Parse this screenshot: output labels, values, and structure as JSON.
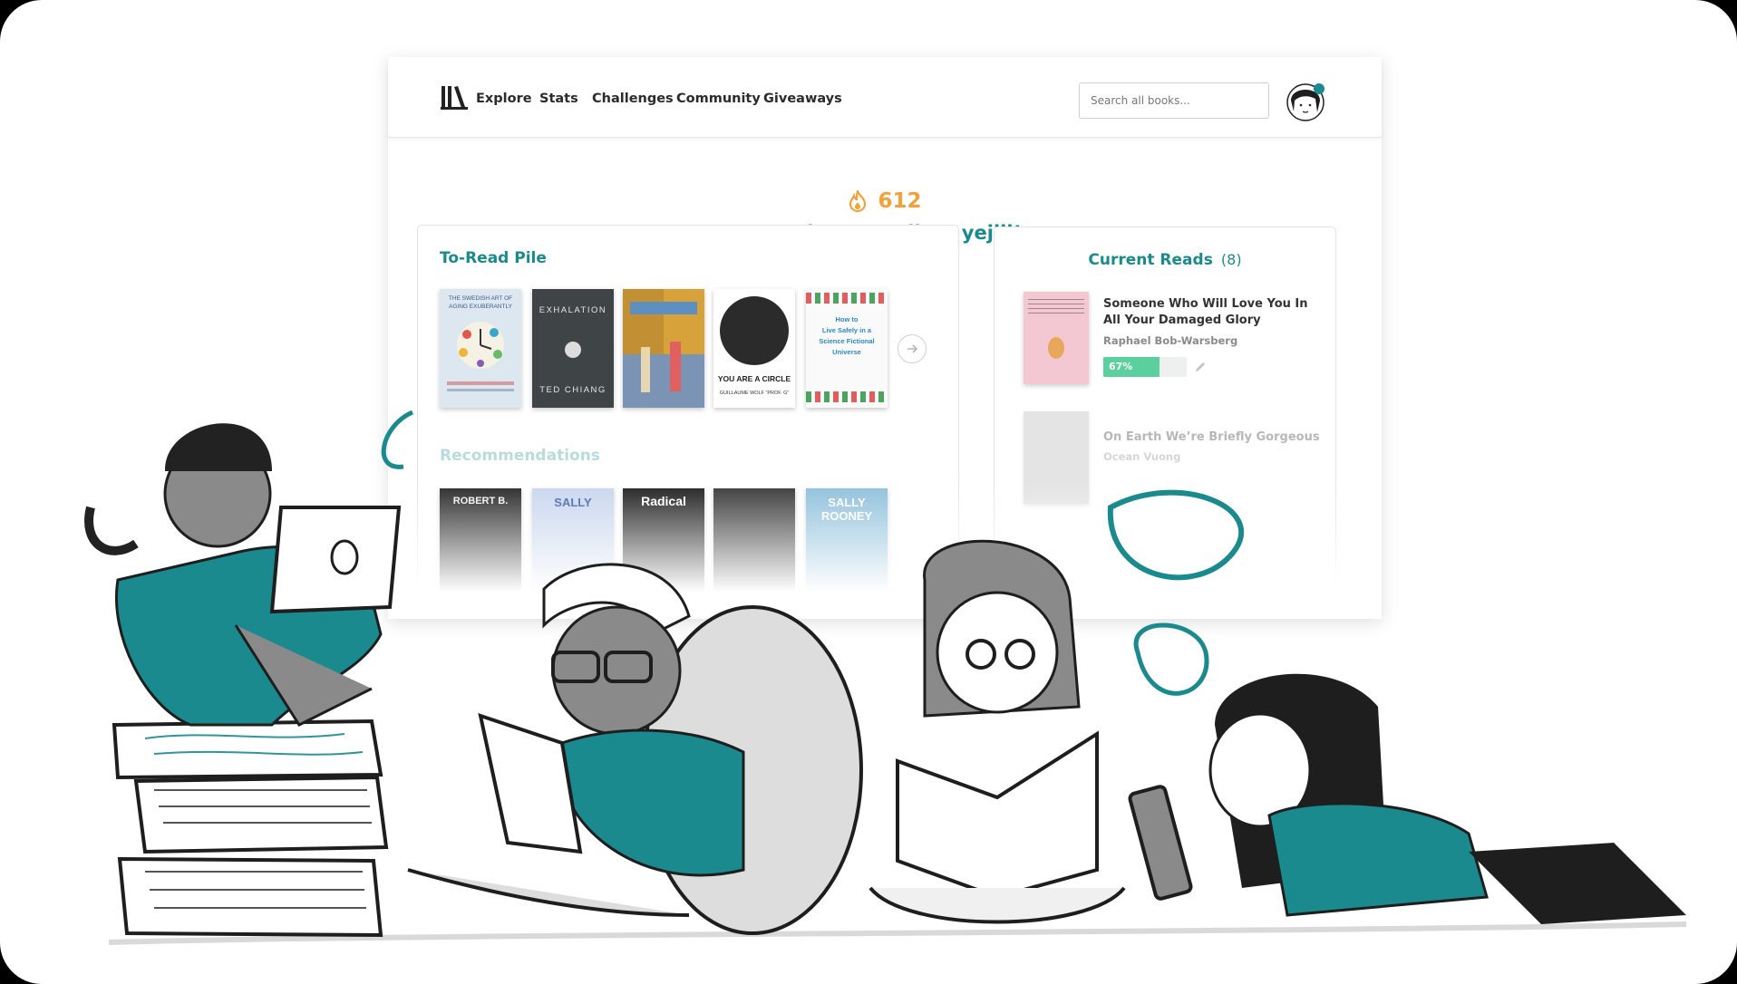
{
  "nav": {
    "links": [
      "Explore",
      "Stats",
      "Challenges",
      "Community",
      "Giveaways"
    ],
    "search_placeholder": "Search all books..."
  },
  "streak": {
    "count": "612",
    "greeting": "Let’s keep reading, yejiji!"
  },
  "to_read": {
    "title": "To-Read Pile",
    "covers": [
      {
        "text": [
          "THE SWEDISH ART OF",
          "AGING EXUBERANTLY"
        ]
      },
      {
        "text": [
          "EXHALATION",
          "TED CHIANG"
        ]
      },
      {
        "text": []
      },
      {
        "text": [
          "YOU ARE A CIRCLE",
          "GUILLAUME WOLF “PROF. G”"
        ]
      },
      {
        "text": [
          "How to",
          "Live Safely in a",
          "Science Fictional",
          "Universe"
        ]
      }
    ]
  },
  "recommendations": {
    "title": "Recommendations",
    "covers": [
      {
        "text": "ROBERT B."
      },
      {
        "text": "SALLY"
      },
      {
        "text": "Radical"
      },
      {
        "text": ""
      },
      {
        "text": "SALLY ROONEY"
      }
    ]
  },
  "current_reads": {
    "title": "Current Reads",
    "count": "(8)",
    "books": [
      {
        "title_lines": [
          "Someone Who Will Love You In",
          "All Your Damaged Glory"
        ],
        "author": "Raphael Bob-Warsberg",
        "progress_label": "67%",
        "progress": 0.67
      },
      {
        "title_lines": [
          "On Earth We’re Briefly Gorgeous"
        ],
        "author": "Ocean Vuong"
      }
    ]
  },
  "colors": {
    "teal": "#1a8a8e",
    "orange": "#f2a23b",
    "progress_green": "#5ccf9e"
  }
}
